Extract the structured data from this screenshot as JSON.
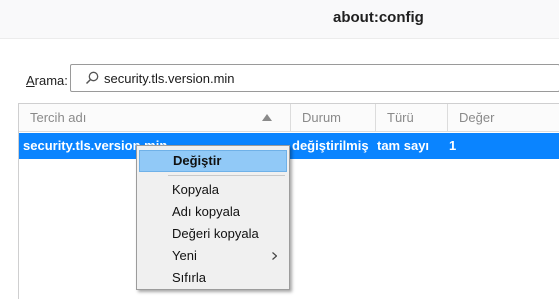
{
  "window": {
    "title": "about:config"
  },
  "search": {
    "label_prefix": "A",
    "label_rest": "rama:",
    "value": "security.tls.version.min"
  },
  "table": {
    "columns": [
      "Tercih adı",
      "Durum",
      "Türü",
      "Değer"
    ],
    "selected_row": {
      "name": "security.tls.version.min",
      "status": "değiştirilmiş",
      "type": "tam sayı",
      "value": "1"
    }
  },
  "context_menu": {
    "items": [
      "Değiştir",
      "Kopyala",
      "Adı kopyala",
      "Değeri kopyala",
      "Yeni",
      "Sıfırla"
    ],
    "active_item": "Değiştir"
  },
  "colors": {
    "selection": "#0a84ff",
    "menu_highlight": "#91c9f7"
  }
}
